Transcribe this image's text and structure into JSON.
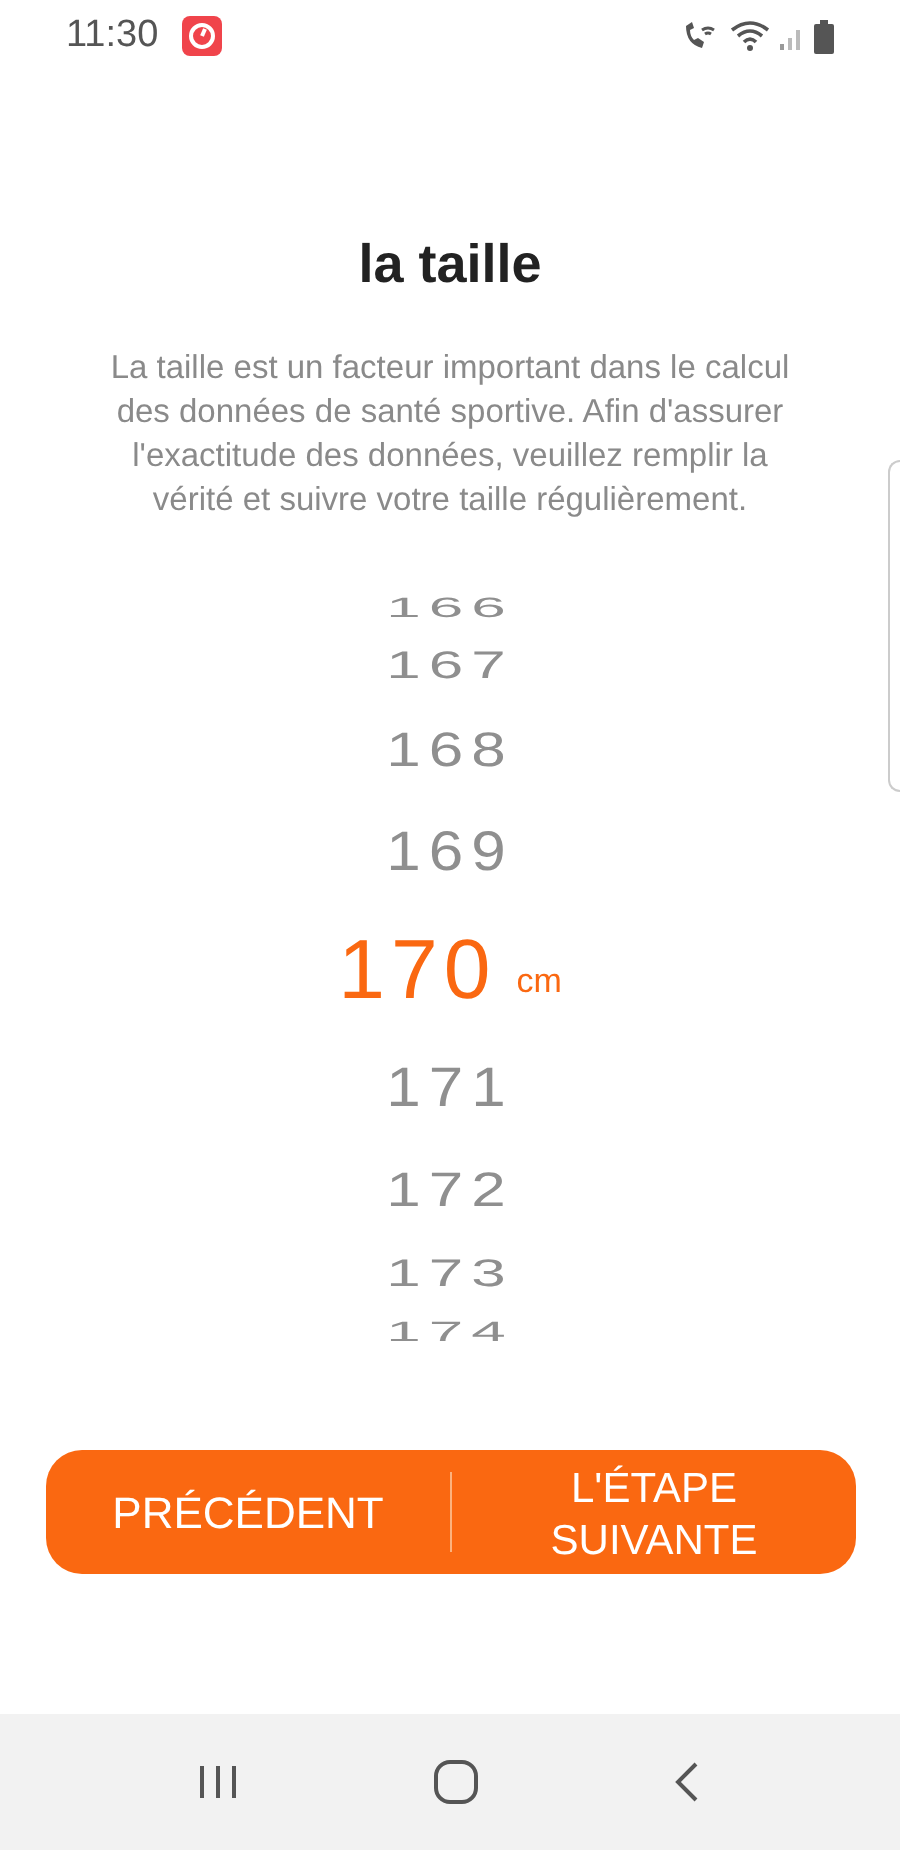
{
  "status_bar": {
    "time": "11:30"
  },
  "title": "la taille",
  "description": "La taille est un facteur important dans le calcul des données de santé sportive. Afin d'assurer l'exactitude des données, veuillez remplir la vérité et suivre votre taille régulièrement.",
  "picker": {
    "unit": "cm",
    "items": [
      {
        "value": "166",
        "selected": false
      },
      {
        "value": "167",
        "selected": false
      },
      {
        "value": "168",
        "selected": false
      },
      {
        "value": "169",
        "selected": false
      },
      {
        "value": "170",
        "selected": true
      },
      {
        "value": "171",
        "selected": false
      },
      {
        "value": "172",
        "selected": false
      },
      {
        "value": "173",
        "selected": false
      },
      {
        "value": "174",
        "selected": false
      }
    ]
  },
  "buttons": {
    "previous": "PRÉCÉDENT",
    "next": "L'ÉTAPE SUIVANTE"
  }
}
